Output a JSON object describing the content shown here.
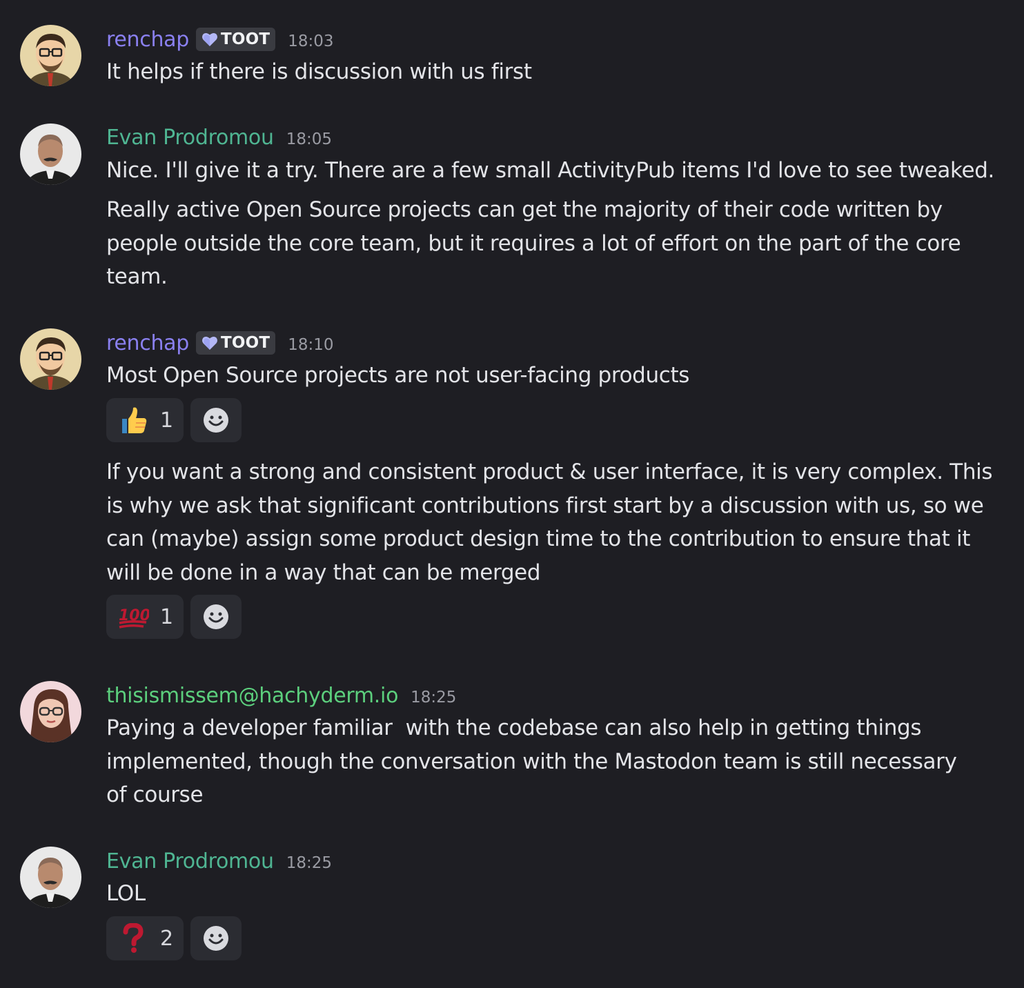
{
  "messages": [
    {
      "author": "renchap",
      "tag": "TOOT",
      "time": "18:03",
      "text": "It helps if there is discussion with us first"
    },
    {
      "author": "Evan Prodromou",
      "time": "18:05",
      "text": "Nice. I'll give it a try. There are a few small ActivityPub items I'd love to see tweaked.",
      "text2": "Really active Open Source projects can get the majority of their code written by people outside the core team, but it requires a lot of effort on the part of the core team."
    },
    {
      "author": "renchap",
      "tag": "TOOT",
      "time": "18:10",
      "text": "Most Open Source projects are not user-facing products",
      "reaction": {
        "emoji": "thumbs-up",
        "count": "1"
      },
      "text2": "If you want a strong and consistent product & user interface, it is very complex. This is why we ask that significant contributions first start by a discussion with us, so we can (maybe) assign some product design time to the contribution to ensure that it will be done in a way that can be merged",
      "reaction2": {
        "emoji": "hundred-points",
        "count": "1"
      }
    },
    {
      "author": "thisismissem@hachyderm.io",
      "time": "18:25",
      "text": "Paying a developer familiar  with the codebase can also help in getting things implemented, though the conversation with the Mastodon team is still necessary of course"
    },
    {
      "author": "Evan Prodromou",
      "time": "18:25",
      "text": "LOL",
      "reaction": {
        "emoji": "question-mark",
        "count": "2"
      }
    }
  ],
  "colors": {
    "background": "#1e1e23",
    "renchap": "#8a80f0",
    "evan": "#4fb592",
    "thisismissem": "#5ccf7d",
    "timestamp": "#9a9ba3",
    "reaction_bg": "#2b2c32"
  }
}
